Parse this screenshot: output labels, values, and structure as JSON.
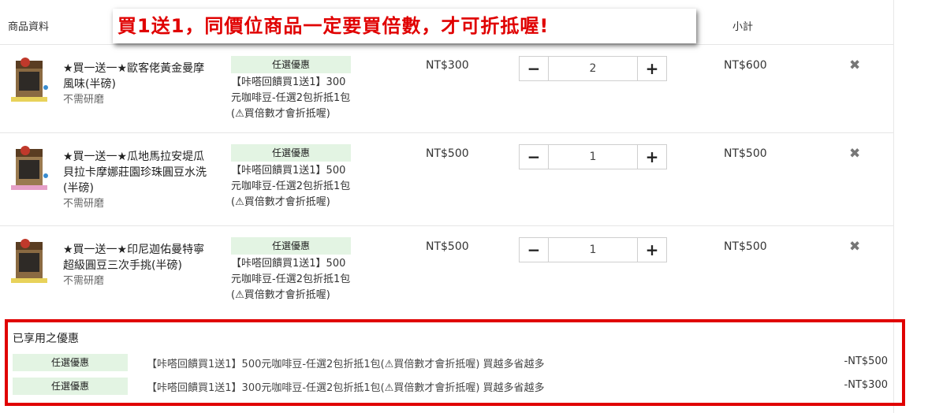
{
  "header": {
    "col_product": "商品資料",
    "col_subtotal": "小計",
    "banner": "買1送1，同價位商品一定要買倍數，才可折抵喔!"
  },
  "items": [
    {
      "name": "★買一送一★歐客佬黃金曼摩風味(半磅)",
      "option": "不需研磨",
      "promo_tag": "任選優惠",
      "promo_desc": "【咔嗒回饋買1送1】300元咖啡豆-任選2包折抵1包(⚠買倍數才會折抵喔)",
      "price": "NT$300",
      "qty": "2",
      "subtotal": "NT$600"
    },
    {
      "name": "★買一送一★瓜地馬拉安堤瓜貝拉卡摩娜莊園珍珠圓豆水洗(半磅)",
      "option": "不需研磨",
      "promo_tag": "任選優惠",
      "promo_desc": "【咔嗒回饋買1送1】500元咖啡豆-任選2包折抵1包(⚠買倍數才會折抵喔)",
      "price": "NT$500",
      "qty": "1",
      "subtotal": "NT$500"
    },
    {
      "name": "★買一送一★印尼迦佑曼特寧超級圓豆三次手挑(半磅)",
      "option": "不需研磨",
      "promo_tag": "任選優惠",
      "promo_desc": "【咔嗒回饋買1送1】500元咖啡豆-任選2包折抵1包(⚠買倍數才會折抵喔)",
      "price": "NT$500",
      "qty": "1",
      "subtotal": "NT$500"
    }
  ],
  "qty_minus": "−",
  "qty_plus": "+",
  "remove_symbol": "✖",
  "discounts": {
    "title": "已享用之優惠",
    "rows": [
      {
        "tag": "任選優惠",
        "desc": "【咔嗒回饋買1送1】500元咖啡豆-任選2包折抵1包(⚠買倍數才會折抵喔) 買越多省越多",
        "amount": "-NT$500"
      },
      {
        "tag": "任選優惠",
        "desc": "【咔嗒回饋買1送1】300元咖啡豆-任選2包折抵1包(⚠買倍數才會折抵喔) 買越多省越多",
        "amount": "-NT$300"
      }
    ]
  },
  "colors": {
    "accent_red": "#e00000",
    "tag_green": "#e3f4e3",
    "divider": "#e6e6e6"
  },
  "icons": [
    "coffee-bag-icon",
    "minus-icon",
    "plus-icon",
    "remove-icon"
  ]
}
